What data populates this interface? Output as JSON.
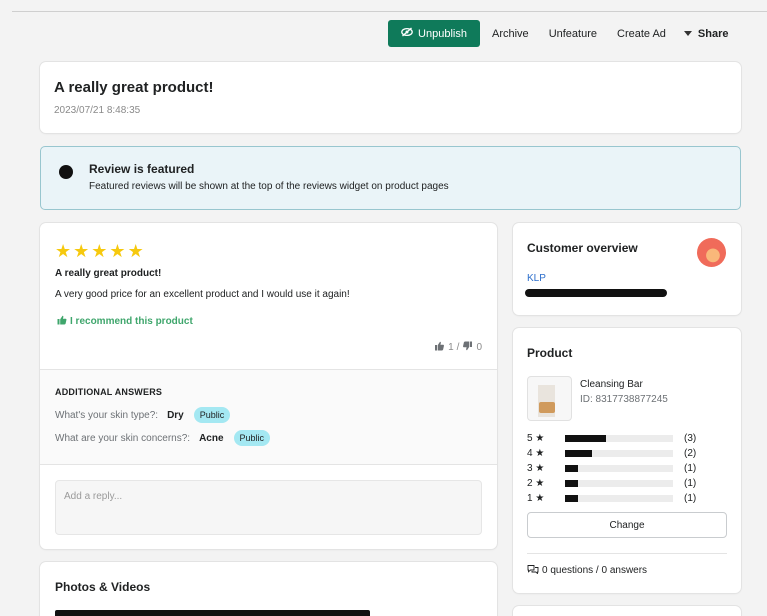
{
  "toolbar": {
    "unpublish_label": "Unpublish",
    "archive_label": "Archive",
    "unfeature_label": "Unfeature",
    "create_ad_label": "Create Ad",
    "share_label": "Share",
    "primary_color": "#0f7a5a"
  },
  "review_header": {
    "title": "A really great product!",
    "timestamp": "2023/07/21 8:48:35"
  },
  "banner": {
    "title": "Review is featured",
    "subtitle": "Featured reviews will be shown at the top of the reviews widget on product pages"
  },
  "review": {
    "rating": 5,
    "title": "A really great product!",
    "body": "A very good price for an excellent product and I would use it again!",
    "recommend_text": "I recommend this product",
    "helpful_votes": "1",
    "vote_separator": "/",
    "unhelpful_votes": "0",
    "star_color": "#f6c90e"
  },
  "additional_answers": {
    "heading": "ADDITIONAL ANSWERS",
    "items": [
      {
        "question": "What's your skin type?:",
        "answer": "Dry",
        "badge": "Public"
      },
      {
        "question": "What are your skin concerns?:",
        "answer": "Acne",
        "badge": "Public"
      }
    ]
  },
  "reply": {
    "placeholder": "Add a reply..."
  },
  "photos": {
    "title": "Photos & Videos"
  },
  "customer": {
    "title": "Customer overview",
    "name": "KLP"
  },
  "product": {
    "title": "Product",
    "name": "Cleansing Bar",
    "id_text": "ID: 8317738877245",
    "distribution": [
      {
        "label": "5 ★",
        "count": "(3)",
        "fraction": 0.38
      },
      {
        "label": "4 ★",
        "count": "(2)",
        "fraction": 0.25
      },
      {
        "label": "3 ★",
        "count": "(1)",
        "fraction": 0.12
      },
      {
        "label": "2 ★",
        "count": "(1)",
        "fraction": 0.12
      },
      {
        "label": "1 ★",
        "count": "(1)",
        "fraction": 0.12
      }
    ],
    "change_label": "Change",
    "qa_text": "0 questions / 0 answers"
  }
}
